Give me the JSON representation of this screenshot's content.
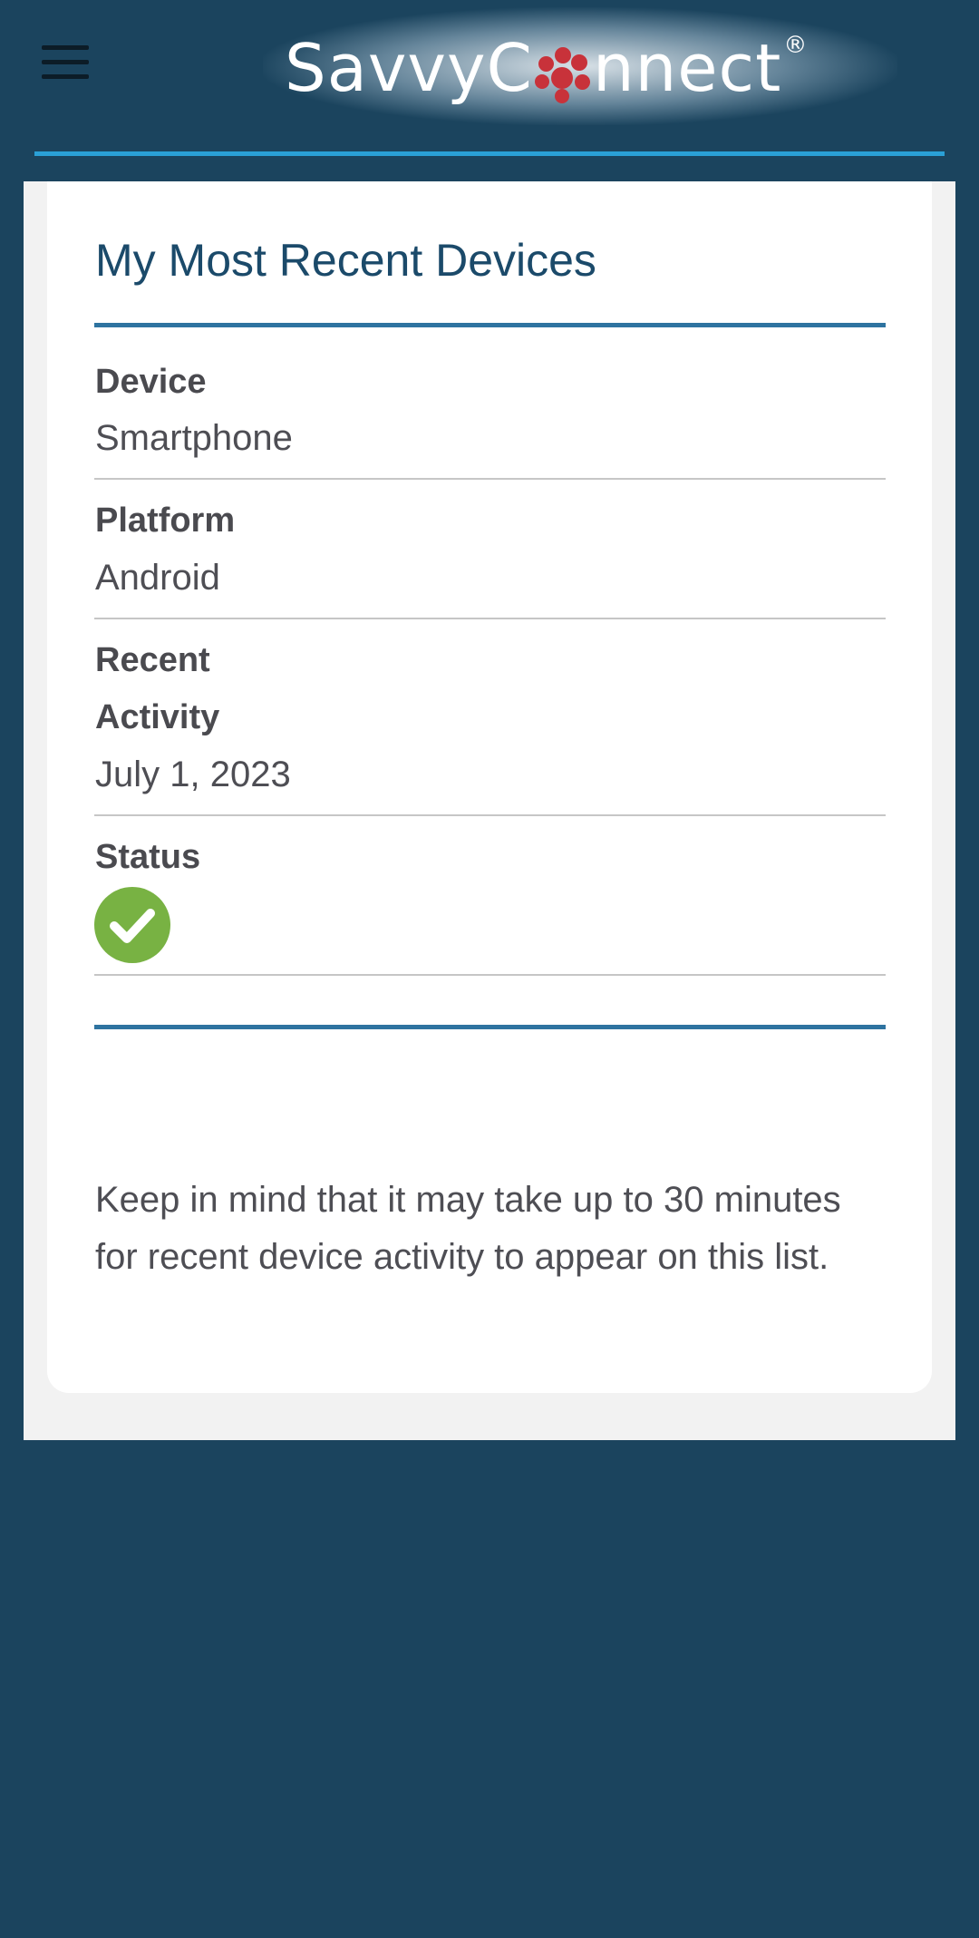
{
  "header": {
    "brand_text_left": "SavvyC",
    "brand_text_right": "nnect",
    "brand_reg": "®",
    "menu_icon": "hamburger-menu-icon",
    "accent_color": "#2aa0d6",
    "logo_dot_color": "#c8323a"
  },
  "card": {
    "title": "My Most Recent Devices",
    "fields": [
      {
        "label": "Device",
        "value": "Smartphone"
      },
      {
        "label": "Platform",
        "value": "Android"
      },
      {
        "label_line1": "Recent",
        "label_line2": "Activity",
        "value": "July 1, 2023"
      },
      {
        "label": "Status",
        "icon": "check-circle-icon",
        "icon_color": "#78b243"
      }
    ],
    "note": "Keep in mind that it may take up to 30 minutes for recent device activity to appear on this list."
  },
  "colors": {
    "background": "#1b445e",
    "title": "#1b4a6a",
    "rule_accent": "#2e73a0"
  }
}
